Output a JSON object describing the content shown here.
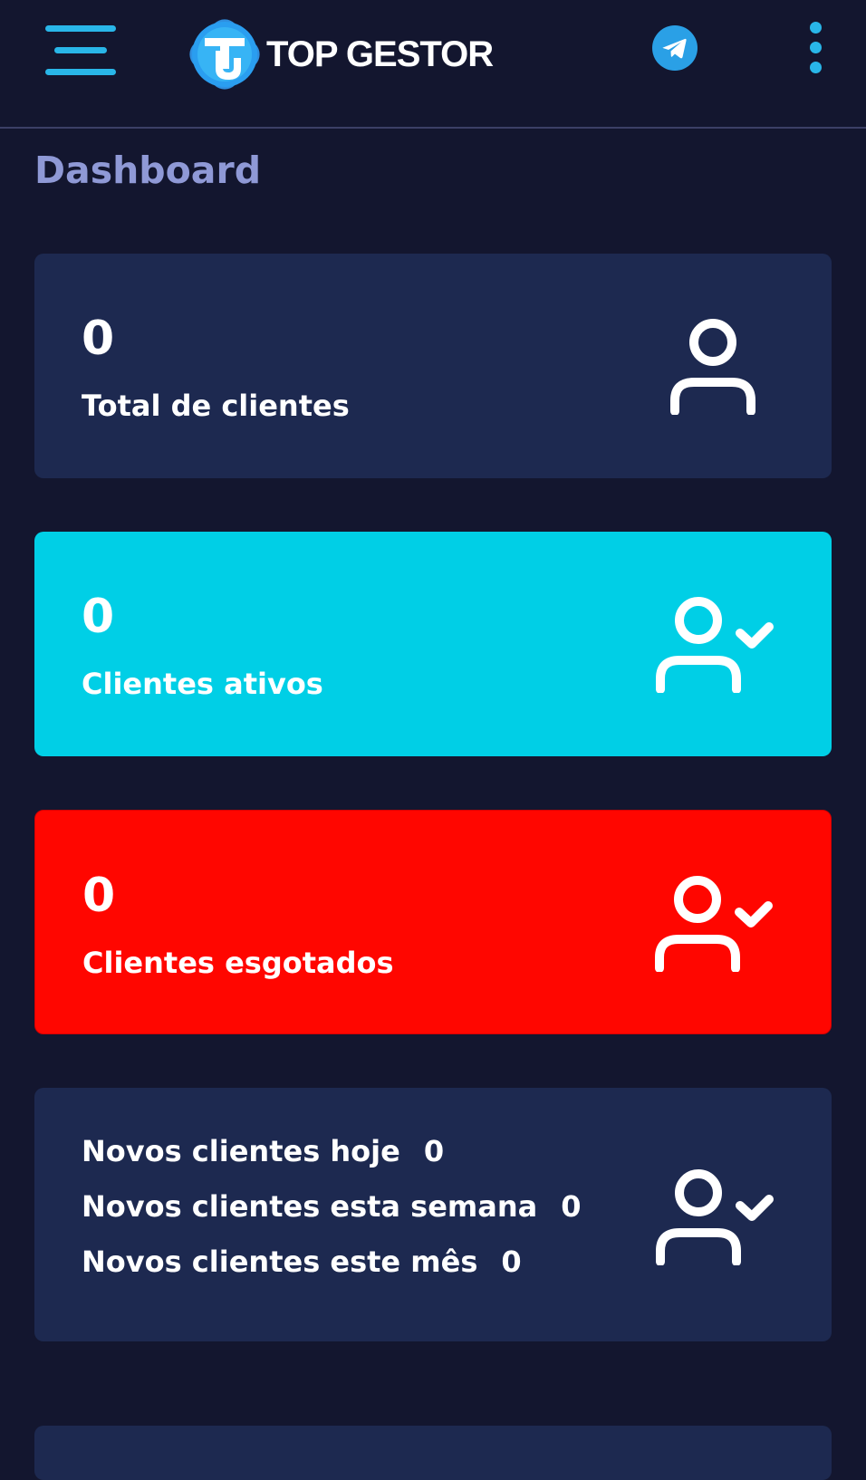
{
  "header": {
    "app_name": "TOP GESTOR",
    "logo_letters": "TG",
    "menu_icon": "hamburger-menu-icon",
    "telegram_icon": "telegram-icon",
    "more_icon": "kebab-menu-icon",
    "accent_color": "#29b6e8"
  },
  "page": {
    "title": "Dashboard"
  },
  "cards": [
    {
      "value": "0",
      "label": "Total de clientes",
      "icon": "user-icon",
      "color": "#1d2950"
    },
    {
      "value": "0",
      "label": "Clientes ativos",
      "icon": "user-check-icon",
      "color": "#00cfe6"
    },
    {
      "value": "0",
      "label": "Clientes esgotados",
      "icon": "user-check-icon",
      "color": "#ff0600"
    }
  ],
  "new_clients": {
    "icon": "user-check-icon",
    "rows": [
      {
        "label": "Novos clientes hoje",
        "value": "0"
      },
      {
        "label": "Novos clientes esta semana",
        "value": "0"
      },
      {
        "label": "Novos clientes este mês",
        "value": "0"
      }
    ]
  }
}
